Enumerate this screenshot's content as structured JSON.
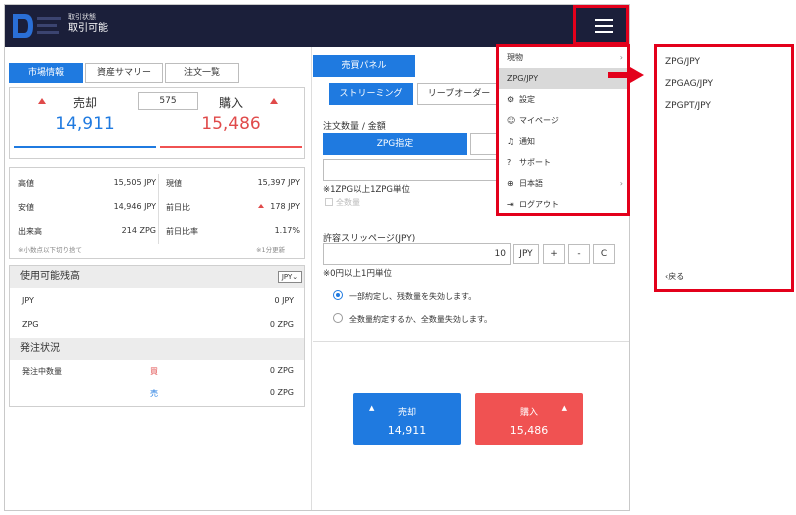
{
  "header": {
    "status_small": "取引状態",
    "status_big": "取引可能",
    "menu_icon": "hamburger-icon"
  },
  "left_tabs": [
    "市場情報",
    "資産サマリー",
    "注文一覧"
  ],
  "quote": {
    "sell_label": "売却",
    "sell_price": "14,911",
    "buy_label": "購入",
    "buy_price": "15,486",
    "spread": "575"
  },
  "stats": {
    "high_label": "高値",
    "high_value": "15,505 JPY",
    "current_label": "現値",
    "current_value": "15,397 JPY",
    "low_label": "安値",
    "low_value": "14,946 JPY",
    "prev_diff_label": "前日比",
    "prev_diff_value": "178 JPY",
    "volume_label": "出来高",
    "volume_value": "214 ZPG",
    "prev_ratio_label": "前日比率",
    "prev_ratio_value": "1.17%",
    "note_left": "※小数点以下切り捨て",
    "note_right": "※1分更新"
  },
  "balance": {
    "title": "使用可能残高",
    "currency_select": "JPY",
    "rows": [
      {
        "label": "JPY",
        "value": "0 JPY"
      },
      {
        "label": "ZPG",
        "value": "0 ZPG"
      }
    ]
  },
  "order_status": {
    "title": "発注状況",
    "label": "発注中数量",
    "buy_mark": "買",
    "buy_value": "0 ZPG",
    "sell_mark": "売",
    "sell_value": "0 ZPG"
  },
  "right_panel": {
    "tab_trade": "売買パネル",
    "tab_streaming": "ストリーミング",
    "tab_leave": "リーブオーダー",
    "qty_label": "注文数量 / 金額",
    "qty_btn": "ZPG指定",
    "unit_note": "※1ZPG以上1ZPG単位",
    "all_label": "全数量",
    "slippage_label": "許容スリッページ(JPY)",
    "slippage_value": "10",
    "slippage_unit": "JPY",
    "plus": "+",
    "minus": "-",
    "clear": "C",
    "slippage_note": "※0円以上1円単位",
    "opt1": "一部約定し、残数量を失効します。",
    "opt2": "全数量約定するか、全数量失効します。",
    "sell_btn_label": "売却",
    "sell_btn_price": "14,911",
    "buy_btn_label": "購入",
    "buy_btn_price": "15,486"
  },
  "dropdown": {
    "items": [
      {
        "label": "現物",
        "icon": "",
        "caret": "›"
      },
      {
        "label": "ZPG/JPY",
        "icon": "",
        "caret": ""
      },
      {
        "label": "設定",
        "icon": "gear-icon",
        "caret": ""
      },
      {
        "label": "マイページ",
        "icon": "user-icon",
        "caret": ""
      },
      {
        "label": "通知",
        "icon": "bell-icon",
        "caret": ""
      },
      {
        "label": "サポート",
        "icon": "help-icon",
        "caret": ""
      },
      {
        "label": "日本語",
        "icon": "globe-icon",
        "caret": "›"
      },
      {
        "label": "ログアウト",
        "icon": "logout-icon",
        "caret": ""
      }
    ]
  },
  "submenu": {
    "items": [
      "ZPG/JPY",
      "ZPGAG/JPY",
      "ZPGPT/JPY"
    ],
    "back": "‹戻る"
  },
  "colors": {
    "header_bg": "#1b1f3a",
    "accent_blue": "#1f7ae0",
    "sell_red": "#f05252",
    "highlight_red": "#e3001b"
  }
}
